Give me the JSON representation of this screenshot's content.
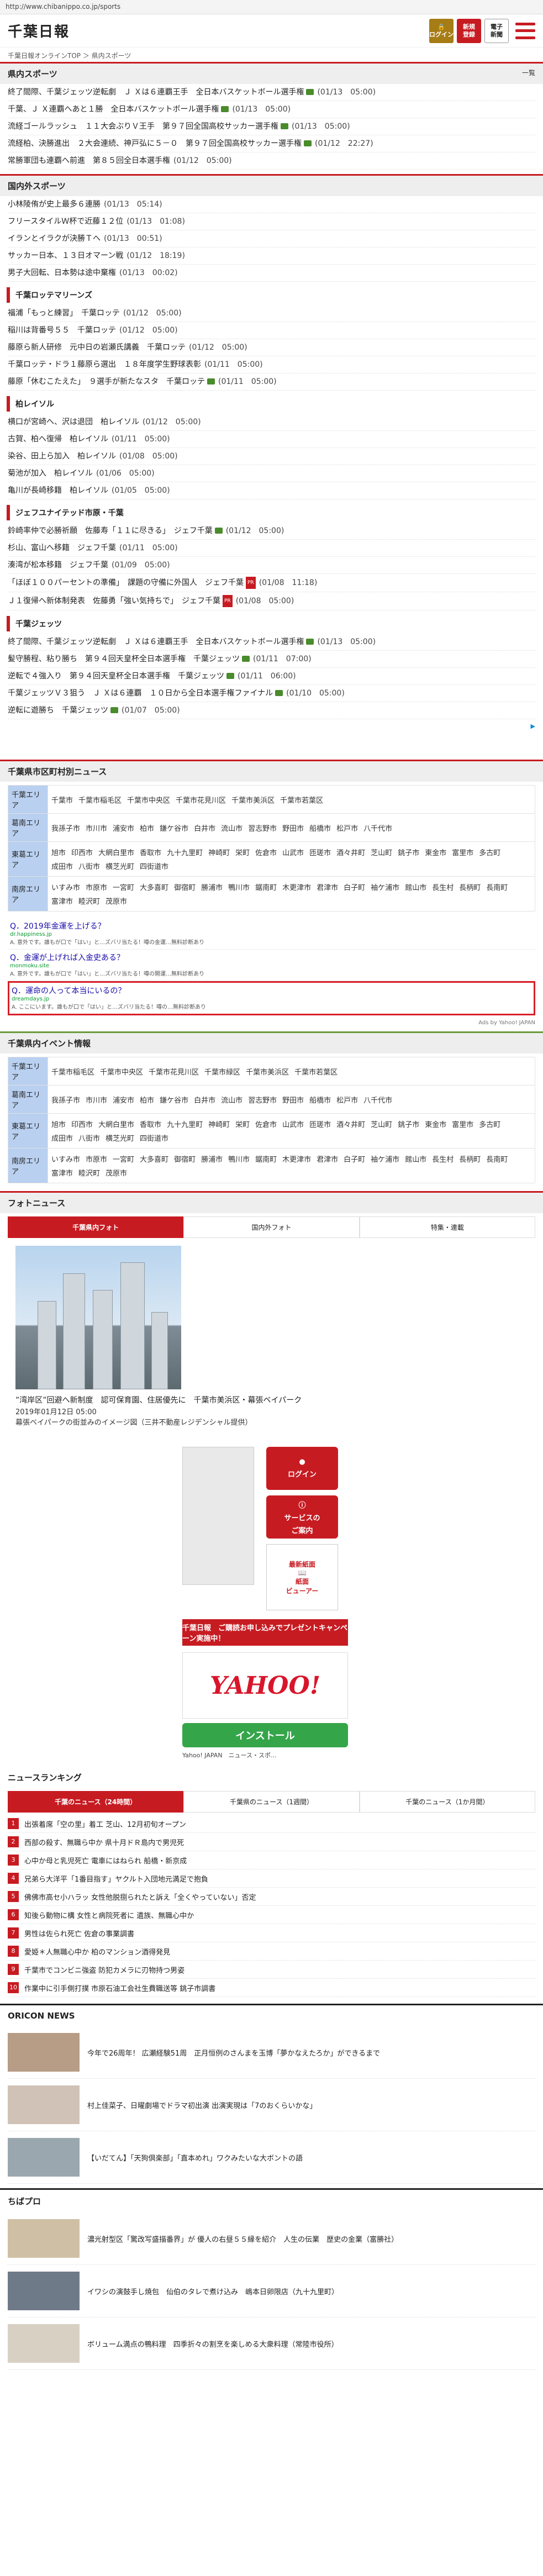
{
  "browser": {
    "url": "http://www.chibanippo.co.jp/sports"
  },
  "header": {
    "logo": "千葉日報",
    "login": "ログイン",
    "register_line1": "新規",
    "register_line2": "登録",
    "enews_line1": "電子",
    "enews_line2": "新聞"
  },
  "breadcrumb": "千葉日報オンラインTOP ＞ 県内スポーツ",
  "prefsports": {
    "title": "県内スポーツ",
    "more": "一覧",
    "items": [
      {
        "text": "終了間際、千葉ジェッツ逆転劇　Ｊ Ｘは６連覇王手　全日本バスケットボール選手権",
        "date": "(01/13　05:00)",
        "photo": true
      },
      {
        "text": "千葉、Ｊ Ｘ連覇へあと１勝　全日本バスケットボール選手権",
        "date": "(01/13　05:00)",
        "photo": true
      },
      {
        "text": "流経ゴールラッシュ　１１大会ぶりＶ王手　第９７回全国高校サッカー選手権",
        "date": "(01/13　05:00)",
        "photo": true
      },
      {
        "text": "流経柏、決勝進出　２大会連続、神戸弘に５－０　第９７回全国高校サッカー選手権",
        "date": "(01/12　22:27)",
        "photo": true
      },
      {
        "text": "常勝軍団も連覇へ前進　第８５回全日本選手権",
        "date": "(01/12　05:00)",
        "photo": false
      }
    ]
  },
  "domestic": {
    "title": "国内外スポーツ",
    "items": [
      {
        "text": "小林陵侑が史上最多６連勝",
        "date": "(01/13　05:14)"
      },
      {
        "text": "フリースタイルＷ杯で近藤１２位",
        "date": "(01/13　01:08)"
      },
      {
        "text": "イランとイラクが決勝Ｔへ",
        "date": "(01/13　00:51)"
      },
      {
        "text": "サッカー日本、１３日オマーン戦",
        "date": "(01/12　18:19)"
      },
      {
        "text": "男子大回転、日本勢は途中棄権",
        "date": "(01/13　00:02)"
      }
    ]
  },
  "marines": {
    "title": "千葉ロッテマリーンズ",
    "items": [
      {
        "text": "福浦「もっと練習」　千葉ロッテ",
        "date": "(01/12　05:00)",
        "photo": false,
        "pr": false
      },
      {
        "text": "稲川は背番号５５　千葉ロッテ",
        "date": "(01/12　05:00)",
        "photo": false,
        "pr": false
      },
      {
        "text": "藤原ら新人研修　元中日の岩瀬氏講義　千葉ロッテ",
        "date": "(01/12　05:00)",
        "photo": false,
        "pr": false
      },
      {
        "text": "千葉ロッテ・ドラ１藤原ら選出　１８年度学生野球表彰",
        "date": "(01/11　05:00)",
        "photo": false,
        "pr": false
      },
      {
        "text": "藤原「休むこたえた」　９選手が新たなスタ　千葉ロッテ",
        "date": "(01/11　05:00)",
        "photo": true,
        "pr": false
      }
    ]
  },
  "reysol": {
    "title": "柏レイソル",
    "items": [
      {
        "text": "横口が宮崎へ、沢は退団　柏レイソル",
        "date": "(01/12　05:00)"
      },
      {
        "text": "古賀、柏へ復帰　柏レイソル",
        "date": "(01/11　05:00)"
      },
      {
        "text": "染谷、田上ら加入　柏レイソル",
        "date": "(01/08　05:00)"
      },
      {
        "text": "菊池が加入　柏レイソル",
        "date": "(01/06　05:00)"
      },
      {
        "text": "亀川が長崎移籍　柏レイソル",
        "date": "(01/05　05:00)"
      }
    ]
  },
  "jef": {
    "title": "ジェフユナイテッド市原・千葉",
    "items": [
      {
        "text": "鈴崎率仲で必勝祈願　佐藤寿「１１に尽きる」　ジェフ千葉",
        "date": "(01/12　05:00)",
        "photo": true,
        "pr": false
      },
      {
        "text": "杉山、富山へ移籍　ジェフ千葉",
        "date": "(01/11　05:00)",
        "photo": false,
        "pr": false
      },
      {
        "text": "湊湾が松本移籍　ジェフ千葉",
        "date": "(01/09　05:00)",
        "photo": false,
        "pr": false
      },
      {
        "text": "「ほぼ１００パーセントの準備」　課題の守備に外国人　ジェフ千葉",
        "date": "(01/08　11:18)",
        "photo": false,
        "pr": true
      },
      {
        "text": "Ｊ１復帰へ新体制発表　佐藤勇「強い気持ちで」　ジェフ千葉",
        "date": "(01/08　05:00)",
        "photo": false,
        "pr": true
      }
    ]
  },
  "jets": {
    "title": "千葉ジェッツ",
    "items": [
      {
        "text": "終了間際、千葉ジェッツ逆転劇　Ｊ Ｘは６連覇王手　全日本バスケットボール選手権",
        "date": "(01/13　05:00)",
        "photo": true
      },
      {
        "text": "髪守勝程、粘り勝ち　第９４回天皇杯全日本選手権　千葉ジェッツ",
        "date": "(01/11　07:00)",
        "photo": true
      },
      {
        "text": "逆転で４強入り　第９４回天皇杯全日本選手権　千葉ジェッツ",
        "date": "(01/11　06:00)",
        "photo": true
      },
      {
        "text": "千葉ジェッツＶ３狙う　Ｊ Ｘは６連覇　１０日から全日本選手権ファイナル",
        "date": "(01/10　05:00)",
        "photo": true
      },
      {
        "text": "逆転に遊勝ち　千葉ジェッツ",
        "date": "(01/07　05:00)",
        "photo": true
      }
    ]
  },
  "adchoices": "▶",
  "citynews": {
    "title": "千葉県市区町村別ニュース",
    "areas": [
      {
        "name": "千葉エリア",
        "cities": [
          "千葉市",
          "千葉市稲毛区",
          "千葉市中央区",
          "千葉市花見川区",
          "千葉市美浜区",
          "千葉市若葉区"
        ]
      },
      {
        "name": "葛南エリア",
        "cities": [
          "我孫子市",
          "市川市",
          "浦安市",
          "柏市",
          "鎌ケ谷市",
          "白井市",
          "流山市",
          "習志野市",
          "野田市",
          "船橋市",
          "松戸市",
          "八千代市"
        ]
      },
      {
        "name": "東葛エリア",
        "cities": [
          "旭市",
          "印西市",
          "大網白里市",
          "香取市",
          "九十九里町",
          "神崎町",
          "栄町",
          "佐倉市",
          "山武市",
          "匝瑳市",
          "酒々井町",
          "芝山町",
          "銚子市",
          "東金市",
          "富里市",
          "多古町",
          "成田市",
          "八街市",
          "横芝光町",
          "四街道市"
        ]
      },
      {
        "name": "南房エリア",
        "cities": [
          "いすみ市",
          "市原市",
          "一宮町",
          "大多喜町",
          "御宿町",
          "勝浦市",
          "鴨川市",
          "鋸南町",
          "木更津市",
          "君津市",
          "白子町",
          "袖ケ浦市",
          "館山市",
          "長生村",
          "長柄町",
          "長南町",
          "富津市",
          "睦沢町",
          "茂原市"
        ]
      }
    ],
    "ads": [
      {
        "q": "Q．2019年金運を上げる？",
        "src": "dr.happiness.jp",
        "desc": "A. 意外です。誰もが口で「はい」と…ズバリ当たる！噂の金運…無料診断あり"
      },
      {
        "q": "Q．金運が上げれば入金史ある？",
        "src": "monmoku.site",
        "desc": "A. 意外です。誰もが口で「はい」と…ズバリ当たる！噂の開運…無料診断あり"
      },
      {
        "q": "Q．運命の人って本当にいるの？",
        "src": "dreamdays.jp",
        "desc": "A. ここにいます。誰もが口で「はい」と…ズバリ当たる！噂の…無料診断あり"
      }
    ],
    "credit": "Ads by Yahoo! JAPAN"
  },
  "events": {
    "title": "千葉県内イベント情報",
    "areas": [
      {
        "name": "千葉エリア",
        "cities": [
          "千葉市稲毛区",
          "千葉市中央区",
          "千葉市花見川区",
          "千葉市緑区",
          "千葉市美浜区",
          "千葉市若葉区"
        ]
      },
      {
        "name": "葛南エリア",
        "cities": [
          "我孫子市",
          "市川市",
          "浦安市",
          "柏市",
          "鎌ケ谷市",
          "白井市",
          "流山市",
          "習志野市",
          "野田市",
          "船橋市",
          "松戸市",
          "八千代市"
        ]
      },
      {
        "name": "東葛エリア",
        "cities": [
          "旭市",
          "印西市",
          "大網白里市",
          "香取市",
          "九十九里町",
          "神崎町",
          "栄町",
          "佐倉市",
          "山武市",
          "匝瑳市",
          "酒々井町",
          "芝山町",
          "銚子市",
          "東金市",
          "富里市",
          "多古町",
          "成田市",
          "八街市",
          "横芝光町",
          "四街道市"
        ]
      },
      {
        "name": "南房エリア",
        "cities": [
          "いすみ市",
          "市原市",
          "一宮町",
          "大多喜町",
          "御宿町",
          "勝浦市",
          "鴨川市",
          "鋸南町",
          "木更津市",
          "君津市",
          "白子町",
          "袖ケ浦市",
          "館山市",
          "長生村",
          "長柄町",
          "長南町",
          "富津市",
          "睦沢町",
          "茂原市"
        ]
      }
    ]
  },
  "photonews": {
    "title": "フォトニュース",
    "tabs": [
      "千葉県内フォト",
      "国内外フォト",
      "特集・連載"
    ],
    "headline": "”湾岸区”回避へ新制度　認可保育園、住居優先に　千葉市美浜区・幕張ベイパーク",
    "date": "2019年01月12日 05:00",
    "caption": "幕張ベイパークの街並みのイメージ図（三井不動産レジデンシャル提供）"
  },
  "promo": {
    "login": "ログイン",
    "service_line1": "サービスの",
    "service_line2": "ご案内",
    "latest": "最新紙面",
    "viewer_line1": "紙面",
    "viewer_line2": "ビューアー",
    "campaign": "千葉日報　ご購読お申し込みでプレゼントキャンペーン実施中！"
  },
  "yahooapp": {
    "logo": "YAHOO!",
    "install": "インストール",
    "info": "Yahoo! JAPAN　ニュース・スポ..."
  },
  "ranking": {
    "title": "ニュースランキング",
    "tabs": [
      "千葉のニュース（24時間）",
      "千葉県のニュース（1週間）",
      "千葉のニュース（1か月間）"
    ],
    "items": [
      {
        "rank": "1",
        "text": "出張着席「空の里」着工 芝山、12月初旬オープン"
      },
      {
        "rank": "2",
        "text": "西部の殺す、無職ら中か 県十月ドＲ島内で男児死"
      },
      {
        "rank": "3",
        "text": "心中か母と乳児死亡 電車にはねられ 船橋・新京成"
      },
      {
        "rank": "4",
        "text": "兄弟ら大洋平「1番目指す」ヤクルト入団地元満足で抱負"
      },
      {
        "rank": "5",
        "text": "佛佛市高セ小ハラッ 女性他脱捌られたと訴え「全くやっていない」否定"
      },
      {
        "rank": "6",
        "text": "知後ら動物に構 女性と病院死者に 遺族、無職心中か"
      },
      {
        "rank": "7",
        "text": "男性は佐られ死亡 佐倉の事業調書"
      },
      {
        "rank": "8",
        "text": "愛姫＊人無職心中か 柏のマンション酒得発見"
      },
      {
        "rank": "9",
        "text": "千葉市でコンビニ強盗 防犯カメラに刃物持つ男姿"
      },
      {
        "rank": "10",
        "text": "作業中に引手側打撲 市原石油工会社生費職送等 銚子市調書"
      }
    ]
  },
  "oricon": {
    "title": "ORICON NEWS",
    "items": [
      "今年で26周年！ 広瀬経験51周　正月恒例のさんまを玉博「夢かなえたろか」ができるまで",
      "村上佳菜子、日曜劇場でドラマ初出演 出演実現は「7のおくらいかな」",
      "【いだてん】「天狗倶楽部」「直本めれ」ワクみたいな大ボントの語"
    ]
  },
  "chibapro": {
    "title": "ちばプロ",
    "items": [
      "濃光射型区「驚改写盛描番界」が 優人の右昼５５縁を紹介　人生の伝業　歴史の金業（富勝社）",
      "イワシの演鼓手し焼包　仙伯のタレで煮け込み　嶋本日卵限店（九十九里町）",
      "ボリューム満点の鴨料理　四季折々の割烹を楽しめる大衆料理（常陸市役所）"
    ]
  }
}
